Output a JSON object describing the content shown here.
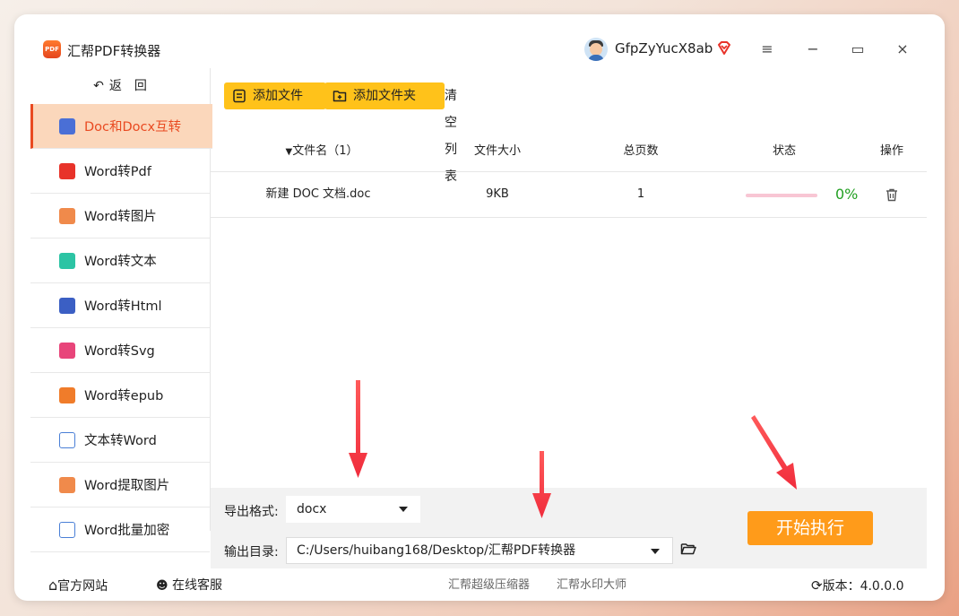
{
  "app": {
    "title": "汇帮PDF转换器",
    "logo_text": "PDF",
    "username": "GfpZyYucX8ab",
    "accent_color": "#e94a21",
    "button_color": "#ffc21a",
    "start_color": "#ff9b1a"
  },
  "window_controls": {
    "menu_icon": "≡",
    "minimize_icon": "−",
    "maximize_icon": "▭",
    "close_icon": "×"
  },
  "sidebar": {
    "back_label": "返　回",
    "items": [
      {
        "label": "Doc和Docx互转",
        "icon": "word-blue-icon",
        "active": true
      },
      {
        "label": "Word转Pdf",
        "icon": "pdf-red-icon"
      },
      {
        "label": "Word转图片",
        "icon": "image-orange-icon"
      },
      {
        "label": "Word转文本",
        "icon": "text-teal-icon"
      },
      {
        "label": "Word转Html",
        "icon": "html-blue-icon"
      },
      {
        "label": "Word转Svg",
        "icon": "svg-pink-icon"
      },
      {
        "label": "Word转epub",
        "icon": "epub-orange-icon"
      },
      {
        "label": "文本转Word",
        "icon": "word-outline-icon"
      },
      {
        "label": "Word提取图片",
        "icon": "image-orange-icon"
      },
      {
        "label": "Word批量加密",
        "icon": "word-outline-icon"
      }
    ]
  },
  "toolbar": {
    "add_file": "添加文件",
    "add_folder": "添加文件夹",
    "clear_list": "清空列表"
  },
  "table": {
    "headers": {
      "filename": "文件名（1）",
      "filesize": "文件大小",
      "pages": "总页数",
      "status": "状态",
      "action": "操作"
    },
    "rows": [
      {
        "filename": "新建 DOC 文档.doc",
        "filesize": "9KB",
        "pages": "1",
        "progress": 0,
        "percent": "0%"
      }
    ]
  },
  "settings": {
    "format_label": "导出格式:",
    "format_value": "docx",
    "dir_label": "输出目录:",
    "dir_value": "C:/Users/huibang168/Desktop/汇帮PDF转换器",
    "start_button": "开始执行"
  },
  "footer": {
    "website": "官方网站",
    "service": "在线客服",
    "link1": "汇帮超级压缩器",
    "link2": "汇帮水印大师",
    "version_label": "版本：",
    "version": "4.0.0.0"
  }
}
